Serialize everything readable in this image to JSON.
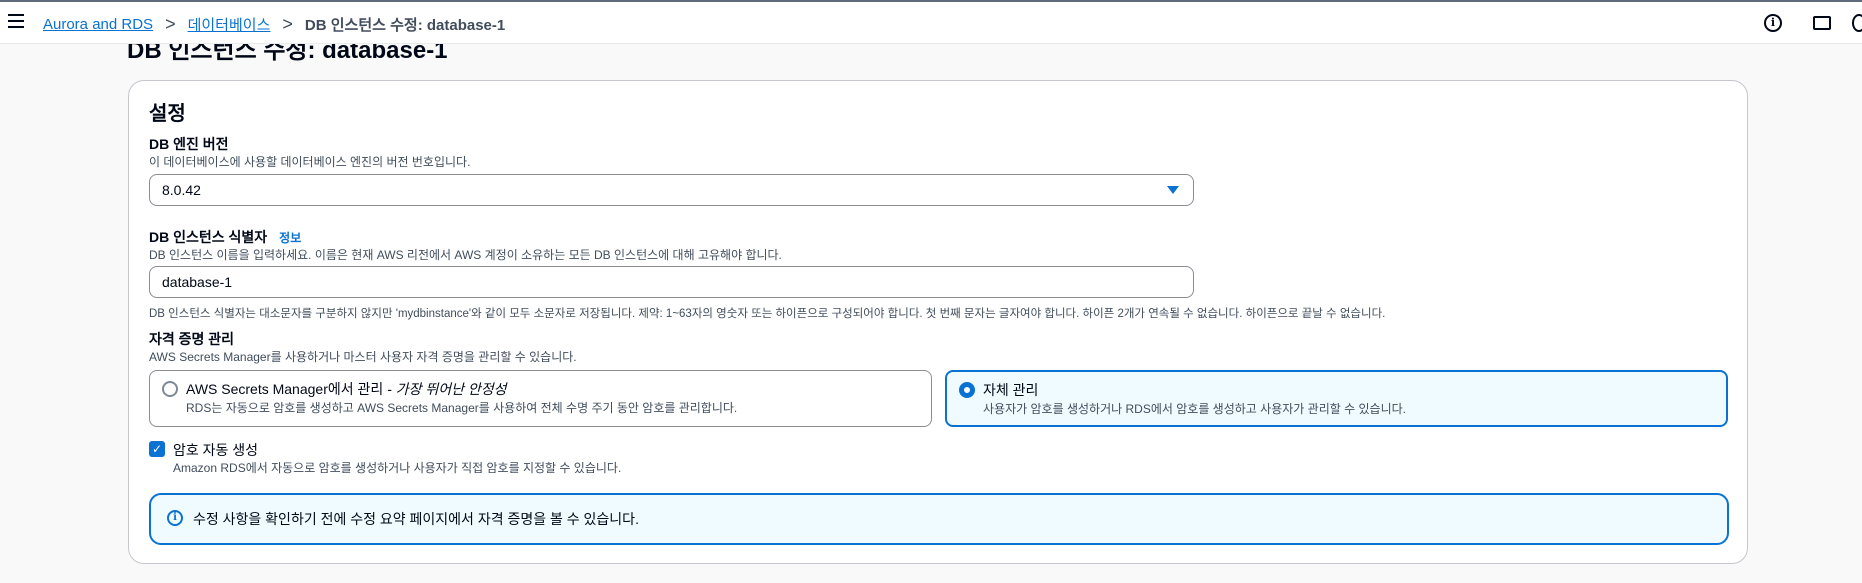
{
  "breadcrumb": {
    "items": [
      "Aurora and RDS",
      "데이터베이스"
    ],
    "current": "DB 인스턴스 수정: database-1",
    "separator": ">"
  },
  "page": {
    "title": "DB 인스턴스 수정: database-1"
  },
  "settings": {
    "title": "설정",
    "engine_version": {
      "label": "DB 엔진 버전",
      "description": "이 데이터베이스에 사용할 데이터베이스 엔진의 버전 번호입니다.",
      "value": "8.0.42"
    },
    "identifier": {
      "label": "DB 인스턴스 식별자",
      "info_link": "정보",
      "description": "DB 인스턴스 이름을 입력하세요. 이름은 현재 AWS 리전에서 AWS 계정이 소유하는 모든 DB 인스턴스에 대해 고유해야 합니다.",
      "value": "database-1",
      "constraint": "DB 인스턴스 식별자는 대소문자를 구분하지 않지만 'mydbinstance'와 같이 모두 소문자로 저장됩니다. 제약: 1~63자의 영숫자 또는 하이픈으로 구성되어야 합니다. 첫 번째 문자는 글자여야 합니다. 하이픈 2개가 연속될 수 없습니다. 하이픈으로 끝날 수 없습니다."
    },
    "credentials": {
      "label": "자격 증명 관리",
      "description": "AWS Secrets Manager를 사용하거나 마스터 사용자 자격 증명을 관리할 수 있습니다.",
      "options": [
        {
          "label": "AWS Secrets Manager에서 관리",
          "label_suffix": " - 가장 뛰어난 안정성",
          "description": "RDS는 자동으로 암호를 생성하고 AWS Secrets Manager를 사용하여 전체 수명 주기 동안 암호를 관리합니다.",
          "selected": false
        },
        {
          "label": "자체 관리",
          "description": "사용자가 암호를 생성하거나 RDS에서 암호를 생성하고 사용자가 관리할 수 있습니다.",
          "selected": true
        }
      ]
    },
    "auto_password": {
      "label": "암호 자동 생성",
      "description": "Amazon RDS에서 자동으로 암호를 생성하거나 사용자가 직접 암호를 지정할 수 있습니다.",
      "checked": true
    },
    "alert": {
      "text": "수정 사항을 확인하기 전에 수정 요약 페이지에서 자격 증명을 볼 수 있습니다."
    }
  },
  "colors": {
    "accent": "#0972d3",
    "selected_bg": "#f0fbff",
    "text": "#000716"
  }
}
